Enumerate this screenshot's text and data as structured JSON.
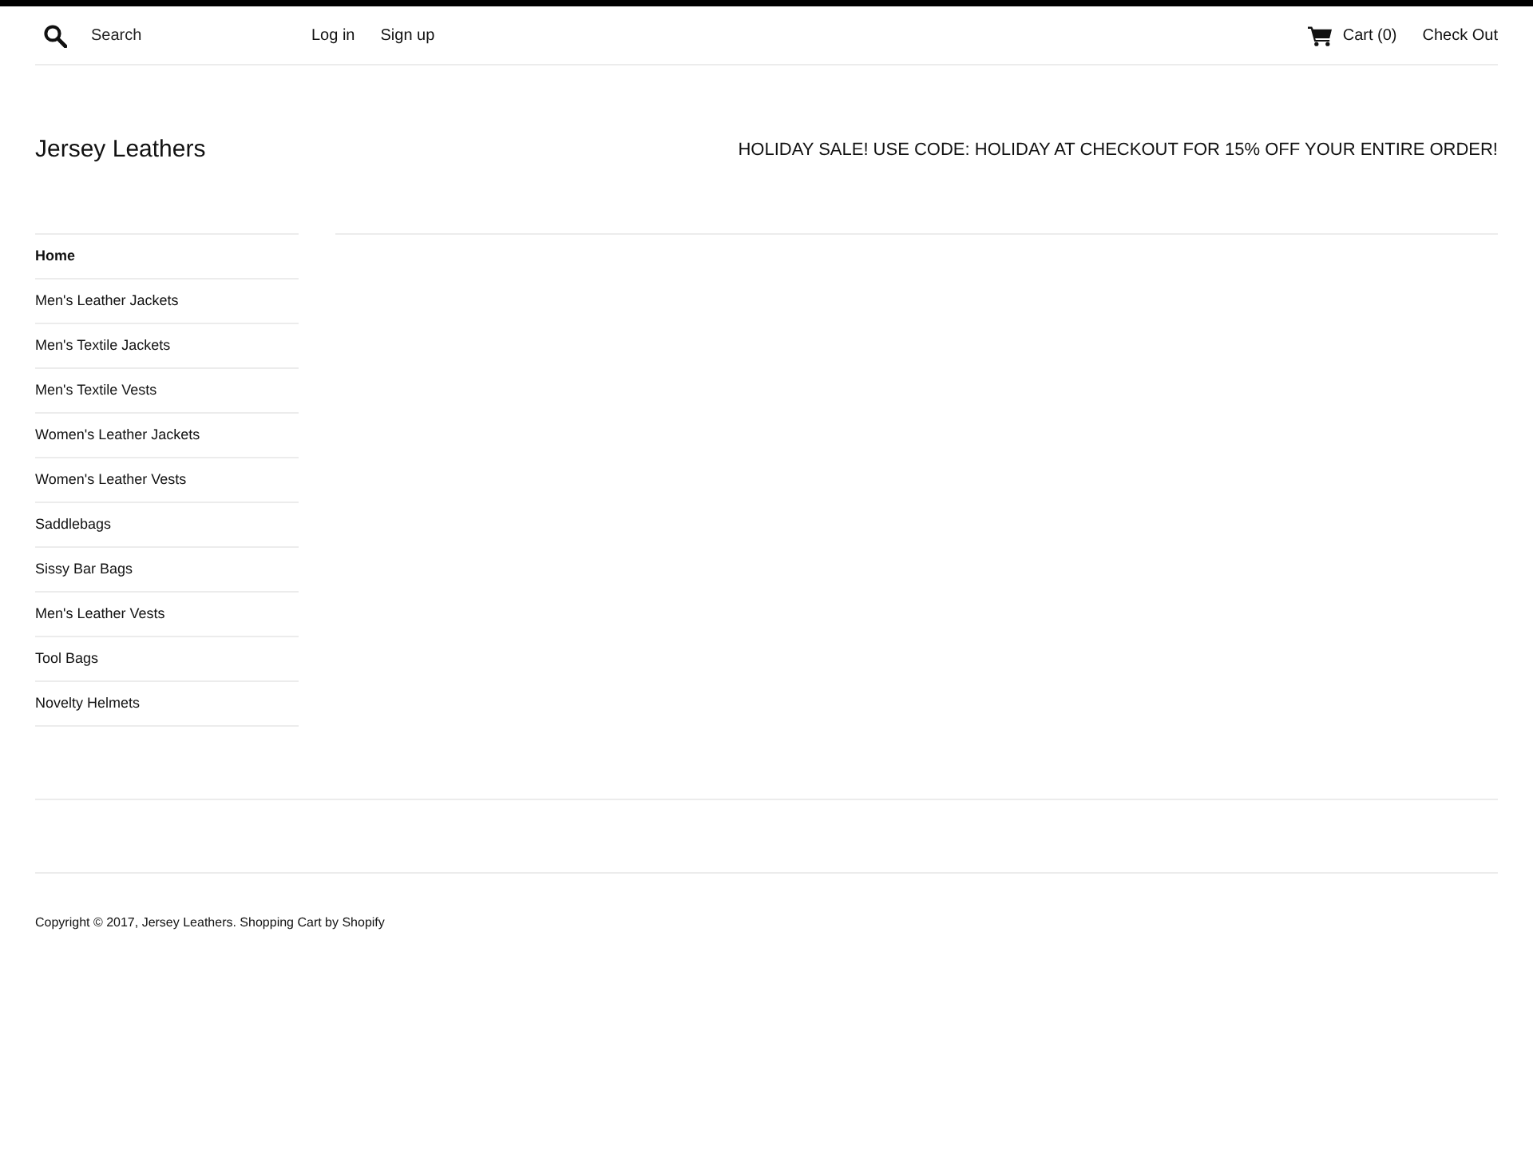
{
  "top_bar": {
    "search": {
      "placeholder": "Search"
    },
    "account_links": [
      "Log in",
      "Sign up"
    ],
    "cart": {
      "label": "Cart (0)"
    },
    "checkout": "Check Out"
  },
  "header": {
    "site_title": "Jersey Leathers",
    "announcement": "HOLIDAY SALE! USE CODE: HOLIDAY AT CHECKOUT FOR 15% OFF YOUR ENTIRE ORDER!"
  },
  "sidebar": {
    "items": [
      {
        "label": "Home",
        "selected": true
      },
      {
        "label": "Men's Leather Jackets",
        "selected": false
      },
      {
        "label": "Men's Textile Jackets",
        "selected": false
      },
      {
        "label": "Men's Textile Vests",
        "selected": false
      },
      {
        "label": "Women's Leather Jackets",
        "selected": false
      },
      {
        "label": "Women's Leather Vests",
        "selected": false
      },
      {
        "label": "Saddlebags",
        "selected": false
      },
      {
        "label": "Sissy Bar Bags",
        "selected": false
      },
      {
        "label": "Men's Leather Vests",
        "selected": false
      },
      {
        "label": "Tool Bags",
        "selected": false
      },
      {
        "label": "Novelty Helmets",
        "selected": false
      }
    ]
  },
  "footer": {
    "copyright": "Copyright © 2017, Jersey Leathers. Shopping Cart by Shopify"
  }
}
